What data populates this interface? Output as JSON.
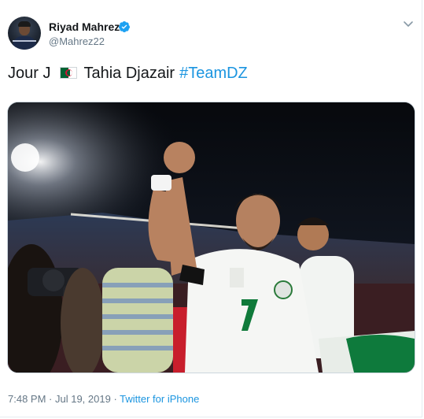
{
  "author": {
    "display_name": "Riyad Mahrez",
    "handle": "@Mahrez22",
    "verified": true,
    "verified_icon": "verified-badge-icon",
    "avatar": "avatar-photo"
  },
  "menu": {
    "icon": "chevron-down-icon"
  },
  "tweet": {
    "text_before": "Jour J",
    "emoji": "algeria-flag-emoji",
    "text_after": "Tahia Djazair",
    "hashtag": "#TeamDZ"
  },
  "media": {
    "type": "photo",
    "subject": "football-player-celebrating-photo"
  },
  "footer": {
    "time": "7:48 PM",
    "separator1": " · ",
    "date": "Jul 19, 2019",
    "separator2": " · ",
    "source": "Twitter for iPhone"
  },
  "colors": {
    "link": "#1b95e0",
    "verified": "#1da1f2",
    "secondary_text": "#657786",
    "primary_text": "#14171a"
  }
}
